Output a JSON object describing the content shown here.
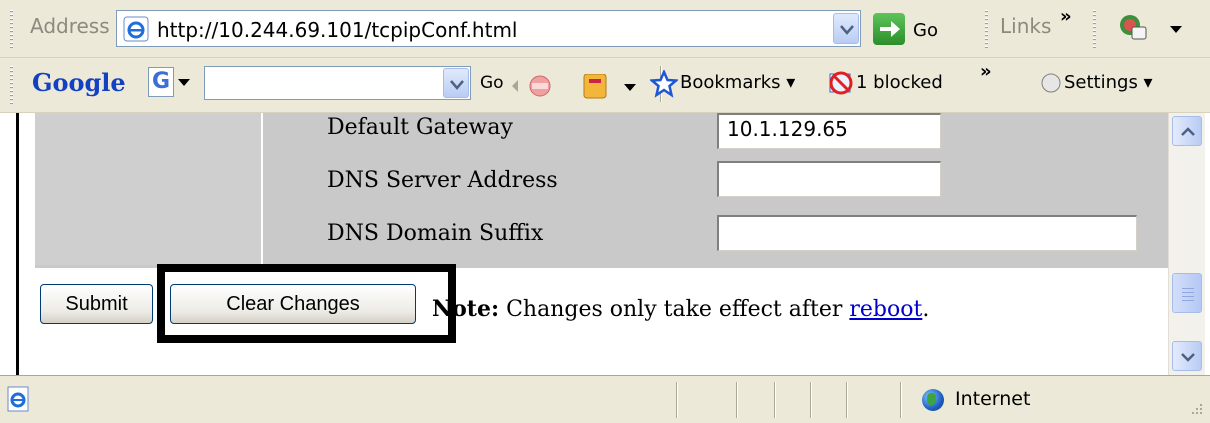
{
  "address_bar": {
    "label": "Address",
    "url": "http://10.244.69.101/tcpipConf.html",
    "go_label": "Go",
    "links_label": "Links",
    "more_chevron": "»"
  },
  "google_toolbar": {
    "logo": "Google",
    "g_button": "G",
    "search_value": "",
    "go_label": "Go",
    "bookmarks_label": "Bookmarks",
    "blocked_label": "1 blocked",
    "more_chevron": "»",
    "settings_label": "Settings"
  },
  "form": {
    "fields": [
      {
        "label": "Default Gateway",
        "value": "10.1.129.65"
      },
      {
        "label": "DNS Server Address",
        "value": ""
      },
      {
        "label": "DNS Domain Suffix",
        "value": ""
      }
    ],
    "submit_label": "Submit",
    "clear_label": "Clear Changes",
    "note_bold": "Note:",
    "note_text": " Changes only take effect after ",
    "note_link": "reboot",
    "note_end": "."
  },
  "status_bar": {
    "zone_label": "Internet"
  },
  "colors": {
    "accent": "#316AC5",
    "toolbar_bg": "#ECE9D8",
    "form_panel": "#C9C9C9",
    "link": "#0000CC"
  },
  "icons": [
    "ie-page-icon",
    "go-arrow-icon",
    "chevron-down-icon",
    "google-g-icon",
    "bookmark-star-icon",
    "popup-blocked-icon",
    "settings-radio-icon",
    "scroll-up-icon",
    "scroll-down-icon",
    "internet-globe-icon"
  ]
}
